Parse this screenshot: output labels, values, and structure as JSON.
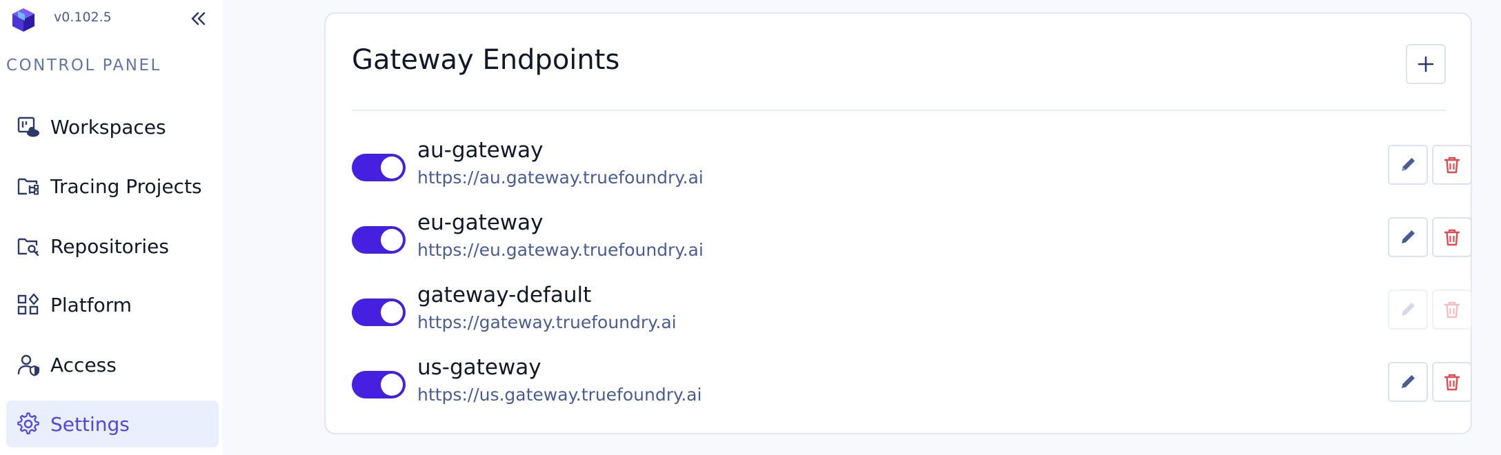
{
  "app": {
    "version": "v0.102.5",
    "section_label": "CONTROL PANEL"
  },
  "sidebar": {
    "items": [
      {
        "label": "Workspaces",
        "icon": "workspaces-cloud-icon"
      },
      {
        "label": "Tracing Projects",
        "icon": "folder-tree-icon"
      },
      {
        "label": "Repositories",
        "icon": "folder-key-icon"
      },
      {
        "label": "Platform",
        "icon": "platform-grid-icon"
      },
      {
        "label": "Access",
        "icon": "user-shield-icon"
      },
      {
        "label": "Settings",
        "icon": "gear-icon",
        "active": true
      }
    ]
  },
  "main": {
    "title": "Gateway Endpoints",
    "endpoints": [
      {
        "name": "au-gateway",
        "url": "https://au.gateway.truefoundry.ai",
        "enabled": true,
        "editable": true
      },
      {
        "name": "eu-gateway",
        "url": "https://eu.gateway.truefoundry.ai",
        "enabled": true,
        "editable": true
      },
      {
        "name": "gateway-default",
        "url": "https://gateway.truefoundry.ai",
        "enabled": true,
        "editable": false
      },
      {
        "name": "us-gateway",
        "url": "https://us.gateway.truefoundry.ai",
        "enabled": true,
        "editable": true
      }
    ]
  },
  "colors": {
    "accent": "#4520e0",
    "active_nav_bg": "#e9effd",
    "active_nav_text": "#4f46e5",
    "edit_icon": "#4a5c94",
    "delete_icon": "#e5484d",
    "url_text": "#4a5c94"
  }
}
